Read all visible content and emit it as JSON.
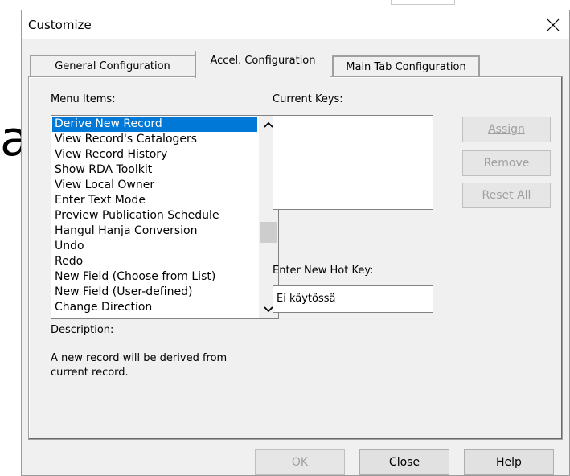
{
  "background": {
    "letter": "a",
    "marks": "︙"
  },
  "dialog": {
    "title": "Customize",
    "tabs": [
      {
        "label": "General Configuration"
      },
      {
        "label": "Accel. Configuration"
      },
      {
        "label": "Main Tab Configuration"
      }
    ],
    "menu_items_label": "Menu Items:",
    "menu_items": [
      "Derive New Record",
      "View Record's Catalogers",
      "View Record History",
      "Show RDA Toolkit",
      "View Local Owner",
      "Enter Text Mode",
      "Preview Publication Schedule",
      "Hangul Hanja Conversion",
      "Undo",
      "Redo",
      "New Field (Choose from List)",
      "New Field (User-defined)",
      "Change Direction"
    ],
    "current_keys_label": "Current Keys:",
    "enter_hot_key_label": "Enter New Hot Key:",
    "hot_key_value": "Ei käytössä",
    "description_label": "Description:",
    "description_text": "A new record will be derived from current record.",
    "buttons": {
      "assign": "Assign",
      "remove": "Remove",
      "reset_all": "Reset All",
      "ok": "OK",
      "close": "Close",
      "help": "Help"
    }
  }
}
